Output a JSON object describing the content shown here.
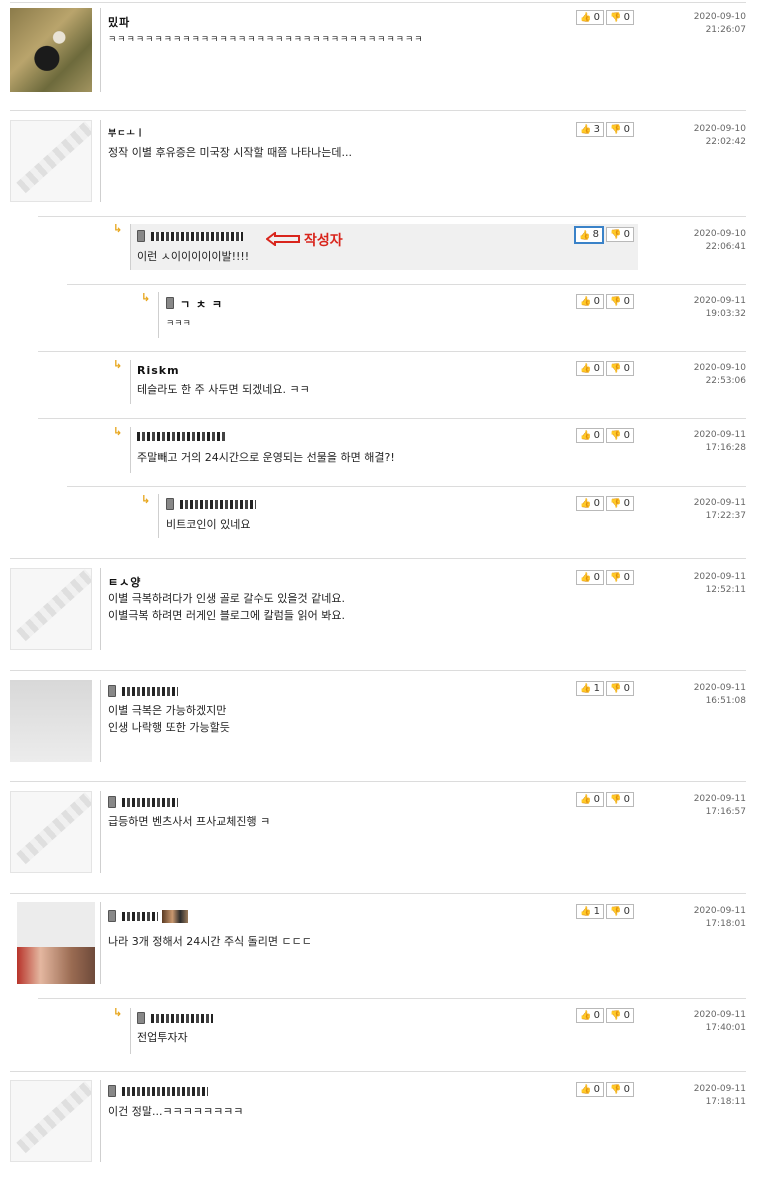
{
  "comments": [
    {
      "author": "밌파",
      "text": "ㅋㅋㅋㅋㅋㅋㅋㅋㅋㅋㅋㅋㅋㅋㅋㅋㅋㅋㅋㅋㅋㅋㅋㅋㅋㅋㅋㅋㅋㅋㅋㅋㅋㅋ",
      "up": "0",
      "down": "0",
      "date": "2020-09-10",
      "time": "21:26:07"
    },
    {
      "author": "부ㄷㅗㅣ",
      "text": "정작 이별 후유증은 미국장 시작할 때쯤 나타나는데...",
      "up": "3",
      "down": "0",
      "date": "2020-09-10",
      "time": "22:02:42"
    },
    {
      "author": "",
      "text": "이런 ㅅ이이이이이발!!!!",
      "up": "8",
      "down": "0",
      "date": "2020-09-10",
      "time": "22:06:41",
      "tag": "작성자"
    },
    {
      "author": "ㄱ ㅊ ㅋ",
      "text": "ㅋㅋㅋ",
      "up": "0",
      "down": "0",
      "date": "2020-09-11",
      "time": "19:03:32"
    },
    {
      "author": "Riskm",
      "text": "테슬라도 한 주 사두면 되겠네요. ㅋㅋ",
      "up": "0",
      "down": "0",
      "date": "2020-09-10",
      "time": "22:53:06"
    },
    {
      "author": "",
      "text": "주말빼고 거의 24시간으로 운영되는 선물을 하면 해결?!",
      "up": "0",
      "down": "0",
      "date": "2020-09-11",
      "time": "17:16:28"
    },
    {
      "author": "",
      "text": "비트코인이 있네요",
      "up": "0",
      "down": "0",
      "date": "2020-09-11",
      "time": "17:22:37"
    },
    {
      "author": "ㅌㅅ양",
      "text": "이별 극복하려다가 인생 골로 갈수도 있을것 같네요.\n이별극복 하려면 러게인 블로그에 칼럼들 읽어 봐요.",
      "up": "0",
      "down": "0",
      "date": "2020-09-11",
      "time": "12:52:11"
    },
    {
      "author": "",
      "text": "이별 극복은 가능하겠지만\n인생 나락행 또한 가능할듯",
      "up": "1",
      "down": "0",
      "date": "2020-09-11",
      "time": "16:51:08"
    },
    {
      "author": "",
      "text": "급등하면 벤츠사서 프사교체진행 ㅋ",
      "up": "0",
      "down": "0",
      "date": "2020-09-11",
      "time": "17:16:57"
    },
    {
      "author": "",
      "text": "나라 3개 정해서 24시간 주식 돌리면 ㄷㄷㄷ",
      "up": "1",
      "down": "0",
      "date": "2020-09-11",
      "time": "17:18:01"
    },
    {
      "author": "",
      "text": "전업투자자",
      "up": "0",
      "down": "0",
      "date": "2020-09-11",
      "time": "17:40:01"
    },
    {
      "author": "",
      "text": "이건 정말...ㅋㅋㅋㅋㅋㅋㅋㅋ",
      "up": "0",
      "down": "0",
      "date": "2020-09-11",
      "time": "17:18:11"
    }
  ],
  "icons": {
    "reply": "reply-arrow-icon",
    "mobile": "mobile-phone-icon",
    "like": "thumbs-up-icon",
    "dislike": "thumbs-down-icon",
    "author_marker": "left-arrow-icon"
  },
  "colors": {
    "accent": "#d9251c",
    "reply_arrow": "#e7a51a",
    "active_vote": "#3a82c8"
  }
}
